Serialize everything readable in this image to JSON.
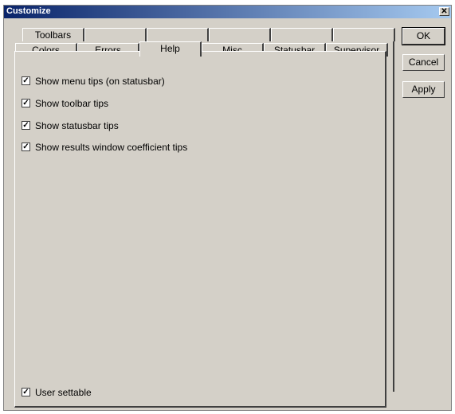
{
  "window": {
    "title": "Customize",
    "close_glyph": "✕"
  },
  "tabs_back": [
    "Toolbars",
    "",
    "",
    "",
    "",
    ""
  ],
  "tabs_front": [
    "Colors",
    "Errors",
    "Help",
    "Misc",
    "Statusbar",
    "Supervisor"
  ],
  "active_tab": "Help",
  "options": [
    {
      "label": "Show menu tips (on statusbar)",
      "checked": true
    },
    {
      "label": "Show toolbar tips",
      "checked": true
    },
    {
      "label": "Show statusbar tips",
      "checked": true
    },
    {
      "label": "Show results window coefficient tips",
      "checked": true
    }
  ],
  "user_settable": {
    "label": "User settable",
    "checked": true
  },
  "buttons": {
    "ok": "OK",
    "cancel": "Cancel",
    "apply": "Apply"
  },
  "check_glyph": "✓"
}
